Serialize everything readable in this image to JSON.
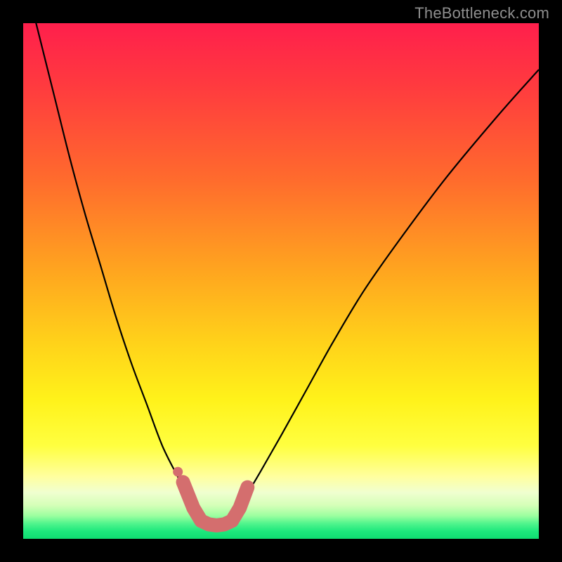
{
  "watermark": {
    "text": "TheBottleneck.com"
  },
  "colors": {
    "background": "#000000",
    "curve_stroke": "#000000",
    "marker_fill": "#d46e6e",
    "gradient_stops": [
      {
        "offset": 0.0,
        "color": "#ff1f4c"
      },
      {
        "offset": 0.12,
        "color": "#ff3a3f"
      },
      {
        "offset": 0.3,
        "color": "#ff6a2d"
      },
      {
        "offset": 0.48,
        "color": "#ffa51f"
      },
      {
        "offset": 0.62,
        "color": "#ffd21a"
      },
      {
        "offset": 0.73,
        "color": "#fff21a"
      },
      {
        "offset": 0.82,
        "color": "#ffff40"
      },
      {
        "offset": 0.88,
        "color": "#ffffa0"
      },
      {
        "offset": 0.91,
        "color": "#f0ffd0"
      },
      {
        "offset": 0.935,
        "color": "#d5ffb8"
      },
      {
        "offset": 0.955,
        "color": "#9dffa0"
      },
      {
        "offset": 0.97,
        "color": "#52f58d"
      },
      {
        "offset": 0.985,
        "color": "#1ee87d"
      },
      {
        "offset": 1.0,
        "color": "#0fdc72"
      }
    ]
  },
  "chart_data": {
    "type": "line",
    "title": "",
    "xlabel": "",
    "ylabel": "",
    "xlim": [
      0,
      100
    ],
    "ylim": [
      0,
      100
    ],
    "grid": false,
    "note": "Axes implied: x = component balance parameter (0–100), y = bottleneck % (0 = no bottleneck, 100 = full bottleneck). Values estimated from pixel positions.",
    "series": [
      {
        "name": "bottleneck-curve",
        "x": [
          0,
          3,
          6,
          9,
          12,
          15,
          18,
          21,
          24,
          27,
          30,
          32,
          34,
          36,
          37.5,
          39,
          41,
          43,
          46,
          50,
          55,
          60,
          66,
          73,
          82,
          92,
          100
        ],
        "y": [
          110,
          98,
          86,
          74,
          63,
          53,
          43,
          34,
          26,
          18,
          12,
          8,
          5,
          3,
          2.5,
          3,
          5,
          8,
          13,
          20,
          29,
          38,
          48,
          58,
          70,
          82,
          91
        ]
      }
    ],
    "markers": {
      "name": "highlight-band",
      "note": "Salmon rounded band near curve minimum; approximate centerline points.",
      "x": [
        31,
        33,
        34.5,
        36,
        37.5,
        39,
        40.5,
        42,
        43.5
      ],
      "y": [
        11,
        6,
        3.5,
        2.8,
        2.6,
        2.8,
        3.5,
        6,
        10
      ],
      "extra_dot": {
        "x": 30,
        "y": 13
      }
    }
  }
}
